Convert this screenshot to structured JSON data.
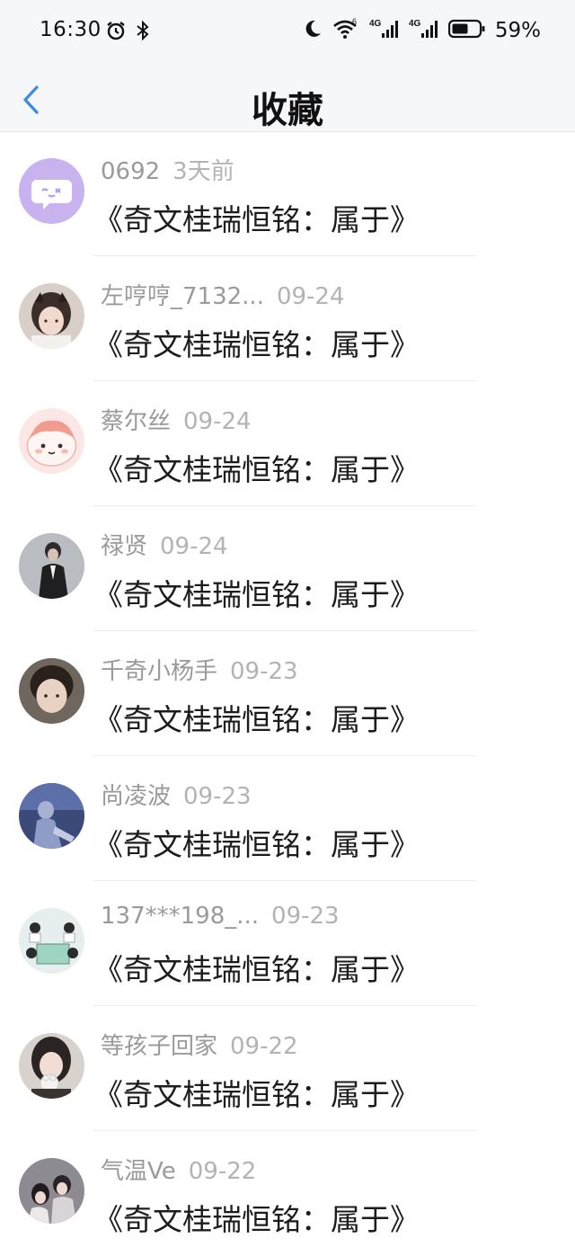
{
  "status_bar": {
    "time": "16:30",
    "battery": "59%",
    "network_1": "4G",
    "network_2": "4G",
    "wifi_badge": "6"
  },
  "header": {
    "title": "收藏"
  },
  "colors": {
    "accent": "#3d8bd8",
    "meta": "#9a9a9a",
    "title": "#1c1c1c",
    "header_bg": "#f6f7f9"
  },
  "items": [
    {
      "user": "0692",
      "date": "3天前",
      "title": "《奇文桂瑞恒铭：属于》",
      "avatar": "chat-bubble-avatar"
    },
    {
      "user": "左哼哼_7132...",
      "date": "09-24",
      "title": "《奇文桂瑞恒铭：属于》",
      "avatar": "user-photo-avatar"
    },
    {
      "user": "蔡尔丝",
      "date": "09-24",
      "title": "《奇文桂瑞恒铭：属于》",
      "avatar": "cartoon-avatar"
    },
    {
      "user": "禄贤",
      "date": "09-24",
      "title": "《奇文桂瑞恒铭：属于》",
      "avatar": "user-photo-avatar"
    },
    {
      "user": "千奇小杨手",
      "date": "09-23",
      "title": "《奇文桂瑞恒铭：属于》",
      "avatar": "user-photo-avatar"
    },
    {
      "user": "尚凌波",
      "date": "09-23",
      "title": "《奇文桂瑞恒铭：属于》",
      "avatar": "user-photo-avatar"
    },
    {
      "user": "137***198_...",
      "date": "09-23",
      "title": "《奇文桂瑞恒铭：属于》",
      "avatar": "illustration-avatar"
    },
    {
      "user": "等孩子回家",
      "date": "09-22",
      "title": "《奇文桂瑞恒铭：属于》",
      "avatar": "user-photo-avatar"
    },
    {
      "user": "气温Ve",
      "date": "09-22",
      "title": "《奇文桂瑞恒铭：属于》",
      "avatar": "user-photo-avatar"
    }
  ]
}
